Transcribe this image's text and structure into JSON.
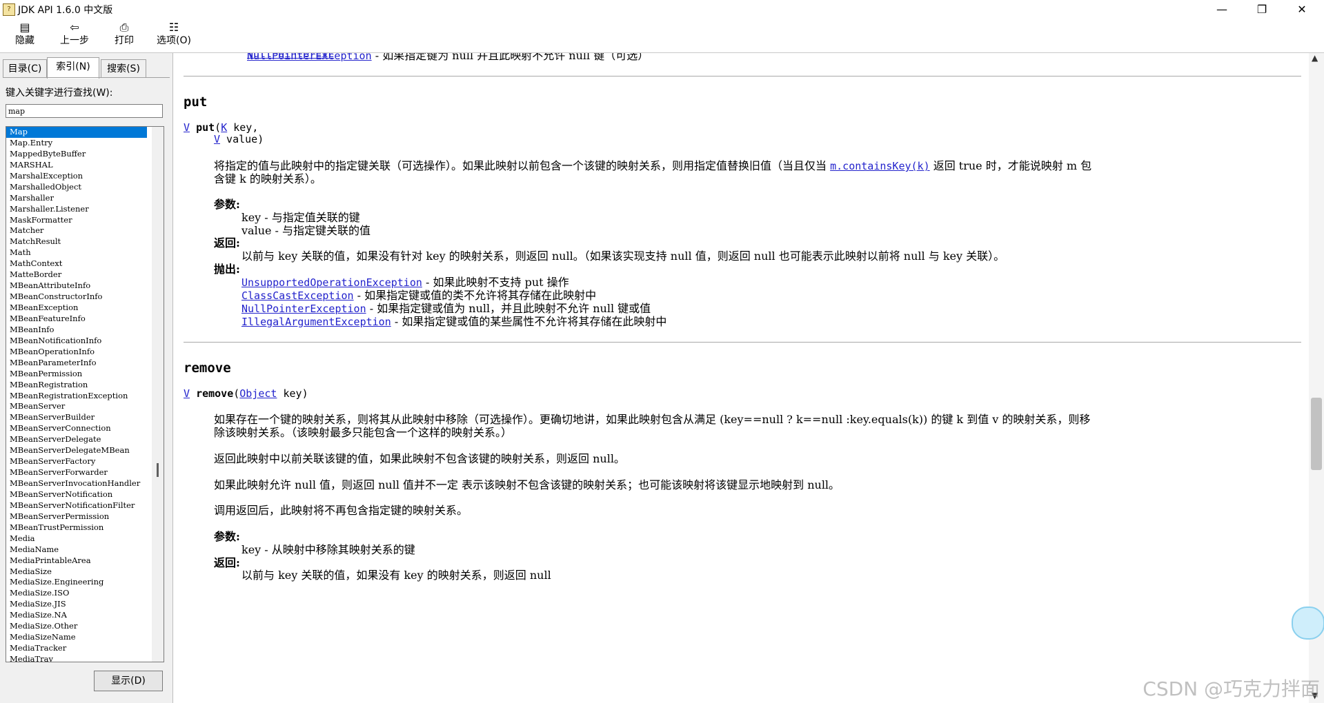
{
  "window": {
    "title": "JDK API 1.6.0 中文版",
    "app_icon": "help-book-icon"
  },
  "toolbar": {
    "hide": "隐藏",
    "back": "上一步",
    "print": "打印",
    "options": "选项(O)"
  },
  "left": {
    "tabs": [
      "目录(C)",
      "索引(N)",
      "搜索(S)"
    ],
    "keyword_label": "键入关键字进行查找(W):",
    "keyword_value": "map",
    "items": [
      "Map",
      "Map.Entry",
      "MappedByteBuffer",
      "MARSHAL",
      "MarshalException",
      "MarshalledObject",
      "Marshaller",
      "Marshaller.Listener",
      "MaskFormatter",
      "Matcher",
      "MatchResult",
      "Math",
      "MathContext",
      "MatteBorder",
      "MBeanAttributeInfo",
      "MBeanConstructorInfo",
      "MBeanException",
      "MBeanFeatureInfo",
      "MBeanInfo",
      "MBeanNotificationInfo",
      "MBeanOperationInfo",
      "MBeanParameterInfo",
      "MBeanPermission",
      "MBeanRegistration",
      "MBeanRegistrationException",
      "MBeanServer",
      "MBeanServerBuilder",
      "MBeanServerConnection",
      "MBeanServerDelegate",
      "MBeanServerDelegateMBean",
      "MBeanServerFactory",
      "MBeanServerForwarder",
      "MBeanServerInvocationHandler",
      "MBeanServerNotification",
      "MBeanServerNotificationFilter",
      "MBeanServerPermission",
      "MBeanTrustPermission",
      "Media",
      "MediaName",
      "MediaPrintableArea",
      "MediaSize",
      "MediaSize.Engineering",
      "MediaSize.ISO",
      "MediaSize.JIS",
      "MediaSize.NA",
      "MediaSize.Other",
      "MediaSizeName",
      "MediaTracker",
      "MediaTray"
    ],
    "show_button": "显示(D)"
  },
  "doc": {
    "top_exc": "NullPointerException",
    "top_desc": " - 如果指定键为 null 并且此映射不允许 null 键（可选）",
    "put": {
      "heading": "put",
      "sig1_type": "V",
      "sig1_name": "put",
      "sig1_k": "K",
      "sig1_rest": " key,",
      "sig2_type": "V",
      "sig2_rest": " value)",
      "desc1": "将指定的值与此映射中的指定键关联（可选操作）。如果此映射以前包含一个该键的映射关系，则用指定值替换旧值（当且仅当",
      "desc_link": "m.containsKey(k)",
      "desc2": "返回 true 时，才能说映射 m 包",
      "desc3": "含键 k 的映射关系）。",
      "params_label": "参数:",
      "param1": "key - 与指定值关联的键",
      "param2": "value - 与指定键关联的值",
      "returns_label": "返回:",
      "returns": "以前与 key 关联的值，如果没有针对 key 的映射关系，则返回 null。（如果该实现支持 null 值，则返回 null 也可能表示此映射以前将 null 与 key 关联）。",
      "throws_label": "抛出:",
      "t1": "UnsupportedOperationException",
      "t1d": " - 如果此映射不支持 put 操作",
      "t2": "ClassCastException",
      "t2d": " - 如果指定键或值的类不允许将其存储在此映射中",
      "t3": "NullPointerException",
      "t3d": " - 如果指定键或值为 null，并且此映射不允许 null 键或值",
      "t4": "IllegalArgumentException",
      "t4d": " - 如果指定键或值的某些属性不允许将其存储在此映射中"
    },
    "remove": {
      "heading": "remove",
      "sig_type": "V",
      "sig_name": "remove",
      "sig_obj": "Object",
      "sig_rest": " key)",
      "d1a": "如果存在一个键的映射关系，则将其从此映射中移除（可选操作）。更确切地讲，如果此映射包含从满足 (key==null ? k==null :key.equals(k)) 的键 k 到值 v 的映射关系，则移",
      "d1b": "除该映射关系。（该映射最多只能包含一个这样的映射关系。）",
      "d2": "返回此映射中以前关联该键的值，如果此映射不包含该键的映射关系，则返回 null。",
      "d3": "如果此映射允许 null 值，则返回 null 值并不一定 表示该映射不包含该键的映射关系；也可能该映射将该键显示地映射到 null。",
      "d4": "调用返回后，此映射将不再包含指定键的映射关系。",
      "params_label": "参数:",
      "param1": "key - 从映射中移除其映射关系的键",
      "returns_label": "返回:",
      "returns_partial": "以前与 key 关联的值，如果没有 key 的映射关系，则返回 null"
    }
  },
  "watermark": "CSDN @巧克力拌面"
}
